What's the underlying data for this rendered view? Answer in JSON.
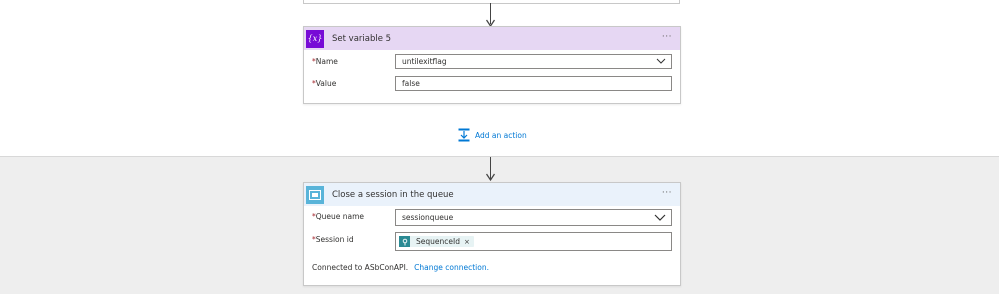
{
  "set_variable_card": {
    "title": "Set variable 5",
    "header_color": "#e6d7f3",
    "icon_color": "#770bd6",
    "icon_glyph": "{x}",
    "fields": [
      {
        "label": "Name",
        "required_mark": "*",
        "value": "untilexitflag",
        "type": "dropdown"
      },
      {
        "label": "Value",
        "required_mark": "*",
        "value": "false",
        "type": "text"
      }
    ]
  },
  "add_action": {
    "label": "Add an action",
    "icon": "add-action-icon"
  },
  "close_session_card": {
    "title": "Close a session in the queue",
    "header_color": "#eaf2fb",
    "icon_color": "#59b4d9",
    "fields": [
      {
        "label": "Queue name",
        "required_mark": "*",
        "value": "sessionqueue",
        "type": "dropdown"
      },
      {
        "label": "Session id",
        "required_mark": "*",
        "token": "SequenceId",
        "token_remove": "×",
        "type": "token"
      }
    ],
    "footer": {
      "connected_text": "Connected to ASbConAPI.",
      "change_link": "Change connection."
    }
  },
  "more_menu_glyph": "···"
}
